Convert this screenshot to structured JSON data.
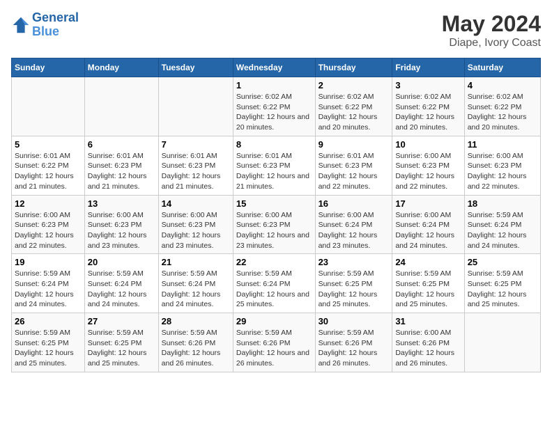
{
  "header": {
    "logo_line1": "General",
    "logo_line2": "Blue",
    "title": "May 2024",
    "subtitle": "Diape, Ivory Coast"
  },
  "days_of_week": [
    "Sunday",
    "Monday",
    "Tuesday",
    "Wednesday",
    "Thursday",
    "Friday",
    "Saturday"
  ],
  "weeks": [
    [
      {
        "day": "",
        "sunrise": "",
        "sunset": "",
        "daylight": ""
      },
      {
        "day": "",
        "sunrise": "",
        "sunset": "",
        "daylight": ""
      },
      {
        "day": "",
        "sunrise": "",
        "sunset": "",
        "daylight": ""
      },
      {
        "day": "1",
        "sunrise": "Sunrise: 6:02 AM",
        "sunset": "Sunset: 6:22 PM",
        "daylight": "Daylight: 12 hours and 20 minutes."
      },
      {
        "day": "2",
        "sunrise": "Sunrise: 6:02 AM",
        "sunset": "Sunset: 6:22 PM",
        "daylight": "Daylight: 12 hours and 20 minutes."
      },
      {
        "day": "3",
        "sunrise": "Sunrise: 6:02 AM",
        "sunset": "Sunset: 6:22 PM",
        "daylight": "Daylight: 12 hours and 20 minutes."
      },
      {
        "day": "4",
        "sunrise": "Sunrise: 6:02 AM",
        "sunset": "Sunset: 6:22 PM",
        "daylight": "Daylight: 12 hours and 20 minutes."
      }
    ],
    [
      {
        "day": "5",
        "sunrise": "Sunrise: 6:01 AM",
        "sunset": "Sunset: 6:22 PM",
        "daylight": "Daylight: 12 hours and 21 minutes."
      },
      {
        "day": "6",
        "sunrise": "Sunrise: 6:01 AM",
        "sunset": "Sunset: 6:23 PM",
        "daylight": "Daylight: 12 hours and 21 minutes."
      },
      {
        "day": "7",
        "sunrise": "Sunrise: 6:01 AM",
        "sunset": "Sunset: 6:23 PM",
        "daylight": "Daylight: 12 hours and 21 minutes."
      },
      {
        "day": "8",
        "sunrise": "Sunrise: 6:01 AM",
        "sunset": "Sunset: 6:23 PM",
        "daylight": "Daylight: 12 hours and 21 minutes."
      },
      {
        "day": "9",
        "sunrise": "Sunrise: 6:01 AM",
        "sunset": "Sunset: 6:23 PM",
        "daylight": "Daylight: 12 hours and 22 minutes."
      },
      {
        "day": "10",
        "sunrise": "Sunrise: 6:00 AM",
        "sunset": "Sunset: 6:23 PM",
        "daylight": "Daylight: 12 hours and 22 minutes."
      },
      {
        "day": "11",
        "sunrise": "Sunrise: 6:00 AM",
        "sunset": "Sunset: 6:23 PM",
        "daylight": "Daylight: 12 hours and 22 minutes."
      }
    ],
    [
      {
        "day": "12",
        "sunrise": "Sunrise: 6:00 AM",
        "sunset": "Sunset: 6:23 PM",
        "daylight": "Daylight: 12 hours and 22 minutes."
      },
      {
        "day": "13",
        "sunrise": "Sunrise: 6:00 AM",
        "sunset": "Sunset: 6:23 PM",
        "daylight": "Daylight: 12 hours and 23 minutes."
      },
      {
        "day": "14",
        "sunrise": "Sunrise: 6:00 AM",
        "sunset": "Sunset: 6:23 PM",
        "daylight": "Daylight: 12 hours and 23 minutes."
      },
      {
        "day": "15",
        "sunrise": "Sunrise: 6:00 AM",
        "sunset": "Sunset: 6:23 PM",
        "daylight": "Daylight: 12 hours and 23 minutes."
      },
      {
        "day": "16",
        "sunrise": "Sunrise: 6:00 AM",
        "sunset": "Sunset: 6:24 PM",
        "daylight": "Daylight: 12 hours and 23 minutes."
      },
      {
        "day": "17",
        "sunrise": "Sunrise: 6:00 AM",
        "sunset": "Sunset: 6:24 PM",
        "daylight": "Daylight: 12 hours and 24 minutes."
      },
      {
        "day": "18",
        "sunrise": "Sunrise: 5:59 AM",
        "sunset": "Sunset: 6:24 PM",
        "daylight": "Daylight: 12 hours and 24 minutes."
      }
    ],
    [
      {
        "day": "19",
        "sunrise": "Sunrise: 5:59 AM",
        "sunset": "Sunset: 6:24 PM",
        "daylight": "Daylight: 12 hours and 24 minutes."
      },
      {
        "day": "20",
        "sunrise": "Sunrise: 5:59 AM",
        "sunset": "Sunset: 6:24 PM",
        "daylight": "Daylight: 12 hours and 24 minutes."
      },
      {
        "day": "21",
        "sunrise": "Sunrise: 5:59 AM",
        "sunset": "Sunset: 6:24 PM",
        "daylight": "Daylight: 12 hours and 24 minutes."
      },
      {
        "day": "22",
        "sunrise": "Sunrise: 5:59 AM",
        "sunset": "Sunset: 6:24 PM",
        "daylight": "Daylight: 12 hours and 25 minutes."
      },
      {
        "day": "23",
        "sunrise": "Sunrise: 5:59 AM",
        "sunset": "Sunset: 6:25 PM",
        "daylight": "Daylight: 12 hours and 25 minutes."
      },
      {
        "day": "24",
        "sunrise": "Sunrise: 5:59 AM",
        "sunset": "Sunset: 6:25 PM",
        "daylight": "Daylight: 12 hours and 25 minutes."
      },
      {
        "day": "25",
        "sunrise": "Sunrise: 5:59 AM",
        "sunset": "Sunset: 6:25 PM",
        "daylight": "Daylight: 12 hours and 25 minutes."
      }
    ],
    [
      {
        "day": "26",
        "sunrise": "Sunrise: 5:59 AM",
        "sunset": "Sunset: 6:25 PM",
        "daylight": "Daylight: 12 hours and 25 minutes."
      },
      {
        "day": "27",
        "sunrise": "Sunrise: 5:59 AM",
        "sunset": "Sunset: 6:25 PM",
        "daylight": "Daylight: 12 hours and 25 minutes."
      },
      {
        "day": "28",
        "sunrise": "Sunrise: 5:59 AM",
        "sunset": "Sunset: 6:26 PM",
        "daylight": "Daylight: 12 hours and 26 minutes."
      },
      {
        "day": "29",
        "sunrise": "Sunrise: 5:59 AM",
        "sunset": "Sunset: 6:26 PM",
        "daylight": "Daylight: 12 hours and 26 minutes."
      },
      {
        "day": "30",
        "sunrise": "Sunrise: 5:59 AM",
        "sunset": "Sunset: 6:26 PM",
        "daylight": "Daylight: 12 hours and 26 minutes."
      },
      {
        "day": "31",
        "sunrise": "Sunrise: 6:00 AM",
        "sunset": "Sunset: 6:26 PM",
        "daylight": "Daylight: 12 hours and 26 minutes."
      },
      {
        "day": "",
        "sunrise": "",
        "sunset": "",
        "daylight": ""
      }
    ]
  ]
}
